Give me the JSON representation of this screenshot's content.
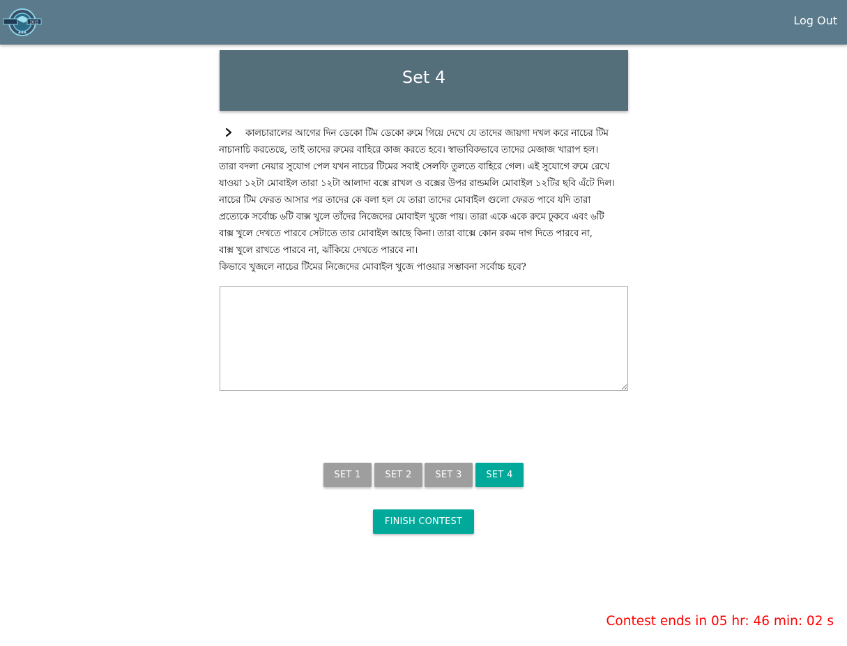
{
  "navbar": {
    "logout_label": "Log Out",
    "logo_text": "2015",
    "background": "#5b7a8b"
  },
  "set_header": {
    "title": "Set 4",
    "background": "#546e7a"
  },
  "question": {
    "lines": [
      "কালচারালের আগের দিন ডেকো টিম ডেকো রুমে গিয়ে দেখে যে তাদের জায়গা দখল করে নাচের টিম",
      "নাচানাচি করতেছে, তাই তাদের রুমের বাহিরে কাজ করতে হবে। স্বাভাবিকভাবে তাদের মেজাজ খারাপ হল।",
      "তারা বদলা নেয়ার সুযোগ পেল যখন নাচের টিমের সবাই সেলফি তুলতে বাহিরে গেল। এই সুযোগে রুমে রেখে",
      "যাওয়া ১২টা মোবাইল তারা ১২টা আলাদা বক্সে রাখল ও বক্সের উপর রান্ডমলি মোবাইল ১২টির ছবি এঁটে দিল।",
      "নাচের টিম ফেরত আসার পর তাদের কে বলা হল যে তারা তাদের মোবাইল গুলো ফেরত পাবে যদি তারা",
      "প্রত্যেকে সর্বোচ্চ ৬টি বাক্স খুলে তাঁদের নিজেদের মোবাইল খুজে পায়। তারা একে একে রুমে ঢুকবে এবং ৬টি",
      "বাক্স খুলে দেখতে পারবে সেটাতে তার মোবাইল আছে কিনা। তারা বাক্সে কোন রকম দাগ দিতে পারবে না,",
      "বাক্স খুলে রাখতে পারবে না, ঝাঁকিয়ে দেখতে পারবে না।",
      "কিভাবে খুজলে নাচের টিমের নিজেদের মোবাইল খুজে পাওয়ার সম্ভাবনা সর্বোচ্চ হবে?"
    ]
  },
  "answer": {
    "value": "",
    "placeholder": ""
  },
  "set_buttons": [
    {
      "label": "SET 1",
      "active": false
    },
    {
      "label": "SET 2",
      "active": false
    },
    {
      "label": "SET 3",
      "active": false
    },
    {
      "label": "SET 4",
      "active": true
    }
  ],
  "finish_label": "FINISH CONTEST",
  "timer_text": "Contest ends in 05 hr: 46 min: 02 s",
  "colors": {
    "accent": "#00a99a",
    "inactive_button": "#9e9e9e",
    "timer": "#ff0000"
  }
}
